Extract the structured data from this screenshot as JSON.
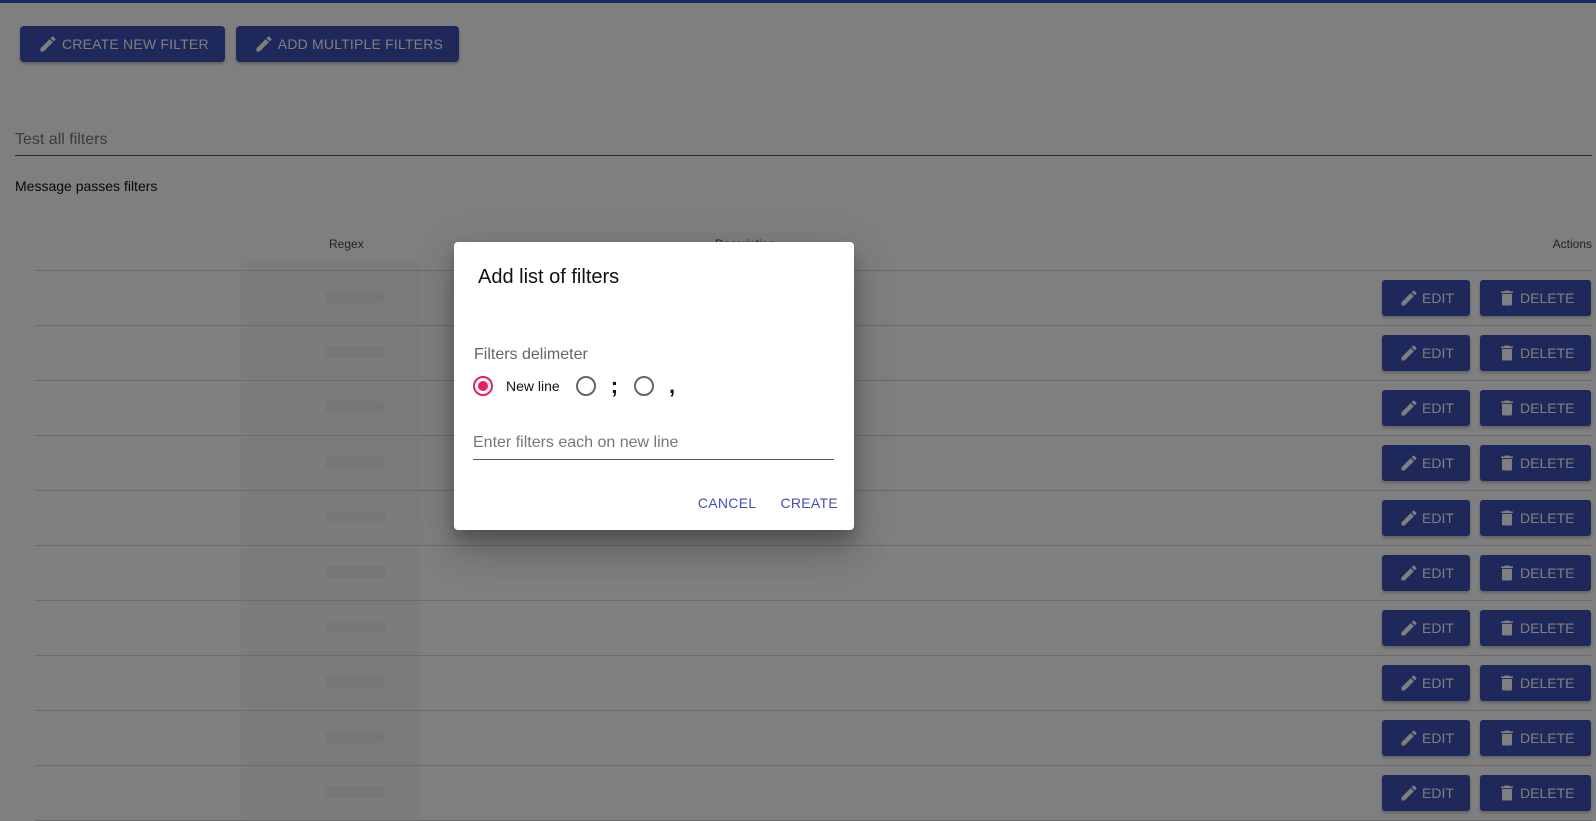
{
  "toolbar": {
    "create_filter_label": "CREATE NEW FILTER",
    "add_multiple_label": "ADD MULTIPLE FILTERS"
  },
  "test": {
    "placeholder": "Test all filters",
    "status": "Message passes filters"
  },
  "table": {
    "columns": {
      "regex": "Regex",
      "description": "Description",
      "actions": "Actions"
    },
    "edit_label": "EDIT",
    "delete_label": "DELETE",
    "row_count": 10
  },
  "dialog": {
    "title": "Add list of filters",
    "delimiter_legend": "Filters delimeter",
    "options": [
      {
        "label": "New line",
        "selected": true
      },
      {
        "label": ";",
        "selected": false
      },
      {
        "label": ",",
        "selected": false
      }
    ],
    "input_placeholder": "Enter filters each on new line",
    "cancel_label": "CANCEL",
    "create_label": "CREATE"
  },
  "colors": {
    "primary": "#3f51b5",
    "accent": "#e91e63"
  },
  "icons": {
    "edit": "pencil-icon",
    "delete": "trash-icon"
  }
}
